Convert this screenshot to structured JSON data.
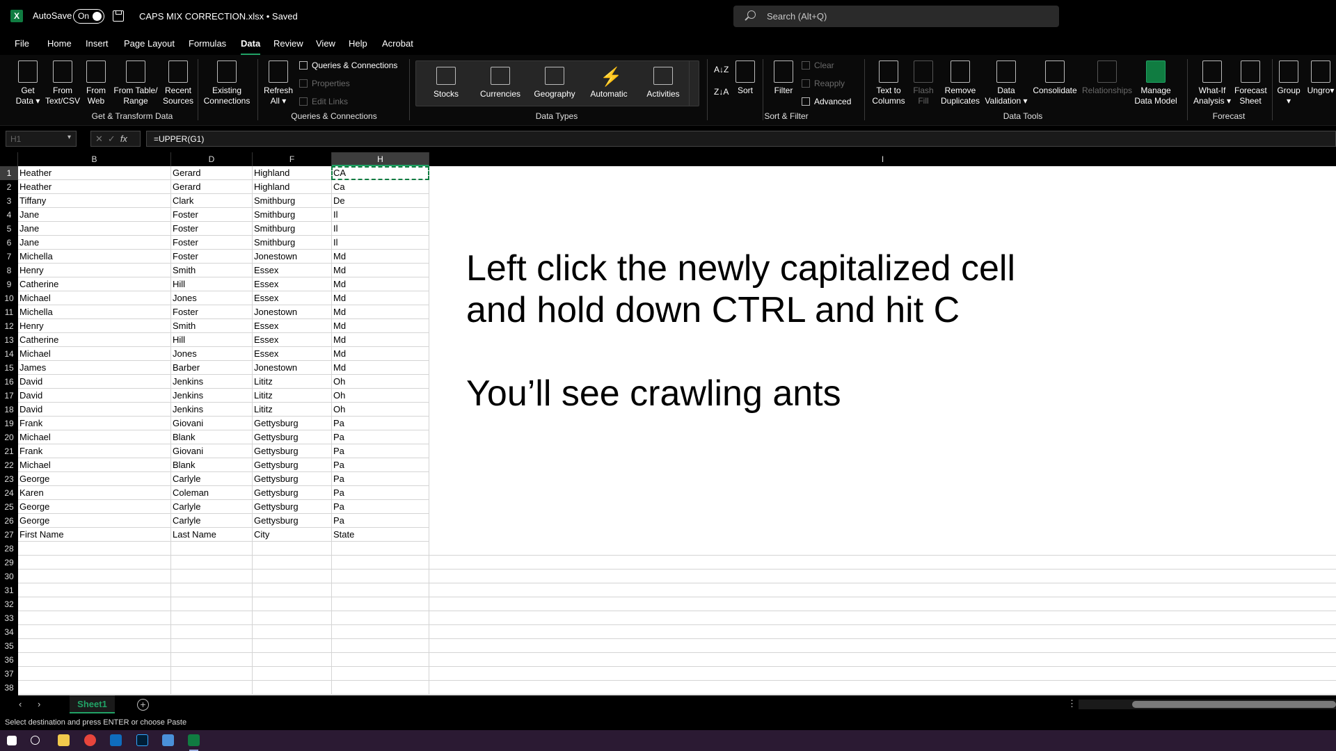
{
  "titlebar": {
    "autosave_label": "AutoSave",
    "toggle_label": "On",
    "doc_title": "CAPS MIX CORRECTION.xlsx • Saved",
    "search_placeholder": "Search (Alt+Q)",
    "logo_letter": "X"
  },
  "menu": [
    {
      "label": "File"
    },
    {
      "label": "Home"
    },
    {
      "label": "Insert"
    },
    {
      "label": "Page Layout"
    },
    {
      "label": "Formulas"
    },
    {
      "label": "Data",
      "active": true
    },
    {
      "label": "Review"
    },
    {
      "label": "View"
    },
    {
      "label": "Help"
    },
    {
      "label": "Acrobat"
    }
  ],
  "ribbon": {
    "get_data": "Get Data ▾",
    "from_text": "From Text/CSV",
    "from_web": "From Web",
    "from_table": "From Table/ Range",
    "recent_sources": "Recent Sources",
    "existing_connections": "Existing Connections",
    "group_get_transform": "Get & Transform Data",
    "refresh_all": "Refresh All ▾",
    "queries_connections": "Queries & Connections",
    "properties": "Properties",
    "edit_links": "Edit Links",
    "group_queries": "Queries & Connections",
    "data_types": [
      "Stocks",
      "Currencies",
      "Geography",
      "Automatic",
      "Activities"
    ],
    "group_data_types": "Data Types",
    "sort_az": "A↓Z",
    "sort_za": "Z↓A",
    "sort": "Sort",
    "filter": "Filter",
    "clear": "Clear",
    "reapply": "Reapply",
    "advanced": "Advanced",
    "group_sort_filter": "Sort & Filter",
    "text_to_columns": "Text to Columns",
    "flash_fill": "Flash Fill",
    "remove_duplicates": "Remove Duplicates",
    "data_validation": "Data Validation ▾",
    "consolidate": "Consolidate",
    "relationships": "Relationships",
    "manage_data_model": "Manage Data Model",
    "group_data_tools": "Data Tools",
    "what_if": "What-If Analysis ▾",
    "forecast_sheet": "Forecast Sheet",
    "group_forecast": "Forecast",
    "group": "Group ▾",
    "ungroup": "Ungro▾"
  },
  "formula_bar": {
    "name_box": "H1",
    "fx": "fx",
    "formula": "=UPPER(G1)"
  },
  "columns": [
    "B",
    "D",
    "F",
    "H",
    "I"
  ],
  "rows": [
    [
      "Heather",
      "Gerard",
      "Highland",
      "CA"
    ],
    [
      "Heather",
      "Gerard",
      "Highland",
      "Ca"
    ],
    [
      "Tiffany",
      "Clark",
      "Smithburg",
      "De"
    ],
    [
      "Jane",
      "Foster",
      "Smithburg",
      "Il"
    ],
    [
      "Jane",
      "Foster",
      "Smithburg",
      "Il"
    ],
    [
      "Jane",
      "Foster",
      "Smithburg",
      "Il"
    ],
    [
      "Michella",
      "Foster",
      "Jonestown",
      "Md"
    ],
    [
      "Henry",
      "Smith",
      "Essex",
      "Md"
    ],
    [
      "Catherine",
      "Hill",
      "Essex",
      "Md"
    ],
    [
      "Michael",
      "Jones",
      "Essex",
      "Md"
    ],
    [
      "Michella",
      "Foster",
      "Jonestown",
      "Md"
    ],
    [
      "Henry",
      "Smith",
      "Essex",
      "Md"
    ],
    [
      "Catherine",
      "Hill",
      "Essex",
      "Md"
    ],
    [
      "Michael",
      "Jones",
      "Essex",
      "Md"
    ],
    [
      "James",
      "Barber",
      "Jonestown",
      "Md"
    ],
    [
      "David",
      "Jenkins",
      "Lititz",
      "Oh"
    ],
    [
      "David",
      "Jenkins",
      "Lititz",
      "Oh"
    ],
    [
      "David",
      "Jenkins",
      "Lititz",
      "Oh"
    ],
    [
      "Frank",
      "Giovani",
      "Gettysburg",
      "Pa"
    ],
    [
      "Michael",
      "Blank",
      "Gettysburg",
      "Pa"
    ],
    [
      "Frank",
      "Giovani",
      "Gettysburg",
      "Pa"
    ],
    [
      "Michael",
      "Blank",
      "Gettysburg",
      "Pa"
    ],
    [
      "George",
      "Carlyle",
      "Gettysburg",
      "Pa"
    ],
    [
      "Karen",
      "Coleman",
      "Gettysburg",
      "Pa"
    ],
    [
      "George",
      "Carlyle",
      "Gettysburg",
      "Pa"
    ],
    [
      "George",
      "Carlyle",
      "Gettysburg",
      "Pa"
    ],
    [
      "First Name",
      "Last Name",
      "City",
      "State"
    ]
  ],
  "row_count": 38,
  "selected_row": 1,
  "note": {
    "line1": "Left click the newly capitalized cell",
    "line2": "and hold down CTRL and hit C",
    "line3": "You’ll see crawling ants"
  },
  "sheet_tab": "Sheet1",
  "status": "Select destination and press ENTER or choose Paste",
  "colors": {
    "accent": "#21a366",
    "excel_green": "#107c41",
    "taskbar": "#2b1a33"
  }
}
